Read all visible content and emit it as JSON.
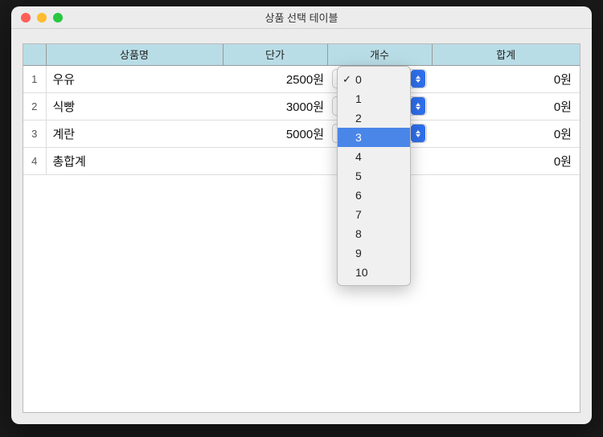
{
  "window": {
    "title": "상품 선택 테이블"
  },
  "table": {
    "headers": {
      "name": "상품명",
      "price": "단가",
      "qty": "개수",
      "total": "합계"
    },
    "rows": [
      {
        "num": "1",
        "name": "우유",
        "price": "2500원",
        "qty": "0",
        "total": "0원"
      },
      {
        "num": "2",
        "name": "식빵",
        "price": "3000원",
        "qty": "0",
        "total": "0원"
      },
      {
        "num": "3",
        "name": "계란",
        "price": "5000원",
        "qty": "0",
        "total": "0원"
      },
      {
        "num": "4",
        "name": "총합계",
        "price": "",
        "qty": "",
        "total": "0원"
      }
    ]
  },
  "dropdown": {
    "options": [
      "0",
      "1",
      "2",
      "3",
      "4",
      "5",
      "6",
      "7",
      "8",
      "9",
      "10"
    ],
    "checked": "0",
    "highlighted": "3"
  }
}
